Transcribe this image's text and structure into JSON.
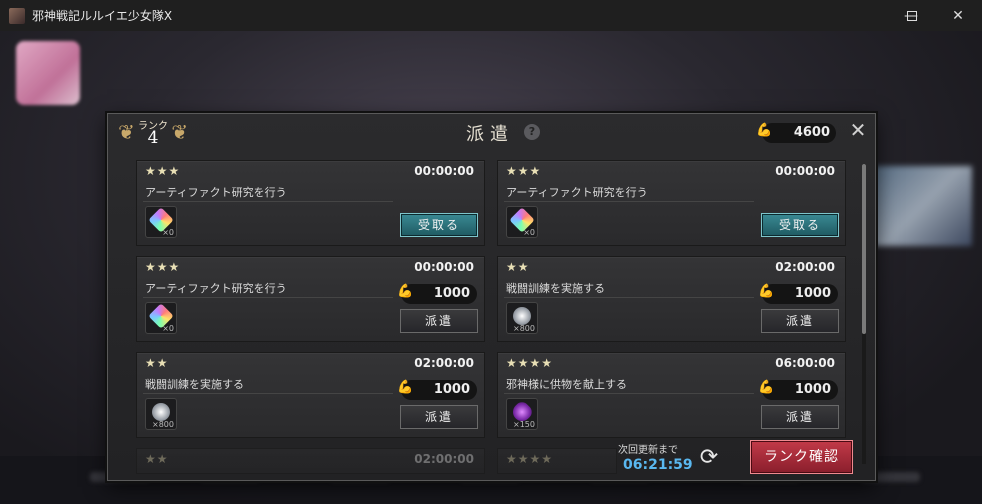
{
  "window": {
    "title": "邪神戦記ルルイエ少女隊X",
    "minimize_icon": "minimize-icon",
    "maximize_icon": "maximize-icon",
    "close_icon": "close-icon"
  },
  "dialog": {
    "rank_label": "ランク",
    "rank_value": "4",
    "title": "派遣",
    "currency": "4600",
    "close_icon": "close-icon",
    "help_icon": "help-icon"
  },
  "missions": [
    {
      "stars": "★★★",
      "timer": "00:00:00",
      "name": "アーティファクト研究を行う",
      "reward_qty": "×0",
      "reward": "rainbow-gem-icon",
      "cost": "",
      "action": "受取る"
    },
    {
      "stars": "★★★",
      "timer": "00:00:00",
      "name": "アーティファクト研究を行う",
      "reward_qty": "×0",
      "reward": "rainbow-gem-icon",
      "cost": "",
      "action": "受取る"
    },
    {
      "stars": "★★★",
      "timer": "00:00:00",
      "name": "アーティファクト研究を行う",
      "reward_qty": "×0",
      "reward": "rainbow-gem-icon",
      "cost": "1000",
      "action": "派遣"
    },
    {
      "stars": "★★",
      "timer": "02:00:00",
      "name": "戦闘訓練を実施する",
      "reward_qty": "×800",
      "reward": "silver-ore-icon",
      "cost": "1000",
      "action": "派遣"
    },
    {
      "stars": "★★",
      "timer": "02:00:00",
      "name": "戦闘訓練を実施する",
      "reward_qty": "×800",
      "reward": "silver-ore-icon",
      "cost": "1000",
      "action": "派遣"
    },
    {
      "stars": "★★★★",
      "timer": "06:00:00",
      "name": "邪神様に供物を献上する",
      "reward_qty": "×150",
      "reward": "purple-crystal-icon",
      "cost": "1000",
      "action": "派遣"
    },
    {
      "stars": "★★",
      "timer": "02:00:00"
    },
    {
      "stars": "★★★★",
      "timer": ""
    }
  ],
  "footer": {
    "next_update_label": "次回更新まで",
    "next_update_time": "06:21:59",
    "rank_confirm": "ランク確認",
    "refresh_icon": "refresh-icon"
  },
  "colors": {
    "claim_button": "#2a707a",
    "rank_button": "#a82a38",
    "timer_blue": "#5ab8f0"
  }
}
